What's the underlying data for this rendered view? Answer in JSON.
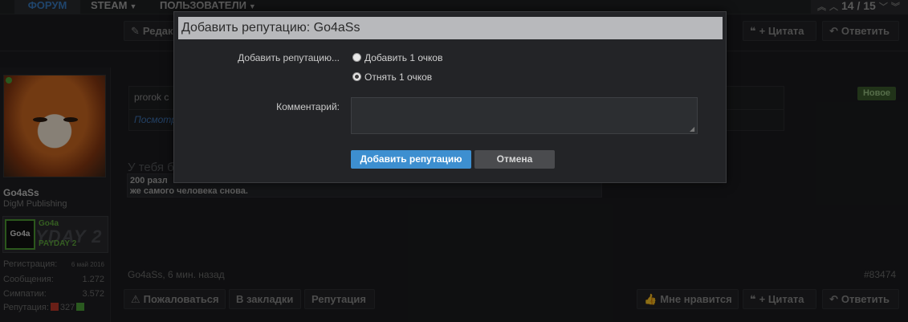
{
  "nav": {
    "tabs": [
      {
        "label": "ФОРУМ",
        "active": true
      },
      {
        "label": "STEAM",
        "has_caret": true
      },
      {
        "label": "ПОЛЬЗОВАТЕЛИ",
        "has_caret": true
      }
    ],
    "pager": {
      "current": "14",
      "total": "15",
      "text": "14 / 15"
    }
  },
  "post_toolbar_top": {
    "edit_label": "Редак",
    "quote_label": "+ Цитата",
    "reply_label": "Ответить"
  },
  "user": {
    "name": "Go4aSs",
    "title": "DigM Publishing",
    "online": true,
    "game_badge": {
      "icon_text": "Go4a",
      "player": "Go4a",
      "game": "PAYDAY 2",
      "logo_text": "YDAY 2"
    },
    "stats": [
      {
        "label": "Регистрация:",
        "value": "6 май 2016"
      },
      {
        "label": "Сообщения:",
        "value": "1.272"
      },
      {
        "label": "Симпатии:",
        "value": "3.572"
      }
    ],
    "reputation": {
      "label": "Репутация:",
      "value": "327",
      "minus_color": "#c0392b",
      "plus_color": "#4da23a"
    }
  },
  "post": {
    "quote_line_1": "prorok c",
    "quote_line_2": "Посмотр",
    "new_badge": "Новое",
    "faded_heading": "У тебя б",
    "warn_line_1": "200 разл",
    "warn_line_2": "же самого человека снова.",
    "author": "Go4aSs",
    "time": "6 мин. назад",
    "meta": "Go4aSs, 6 мин. назад",
    "id": "#83474"
  },
  "post_toolbar_bottom": {
    "report_label": "Пожаловаться",
    "bookmark_label": "В закладки",
    "rep_label": "Репутация",
    "like_label": "Мне нравится",
    "quote_label": "+ Цитата",
    "reply_label": "Ответить"
  },
  "modal": {
    "title": "Добавить репутацию: Go4aSs",
    "rep_field_label": "Добавить репутацию...",
    "options": [
      {
        "label": "Добавить 1 очков",
        "checked": false
      },
      {
        "label": "Отнять 1 очков",
        "checked": true
      }
    ],
    "comment_label": "Комментарий:",
    "comment_value": "",
    "submit_label": "Добавить репутацию",
    "cancel_label": "Отмена"
  },
  "colors": {
    "accent_blue": "#3d8fd0",
    "nav_active": "#3a7cc4",
    "new_badge_bg": "#3c5e2e"
  }
}
